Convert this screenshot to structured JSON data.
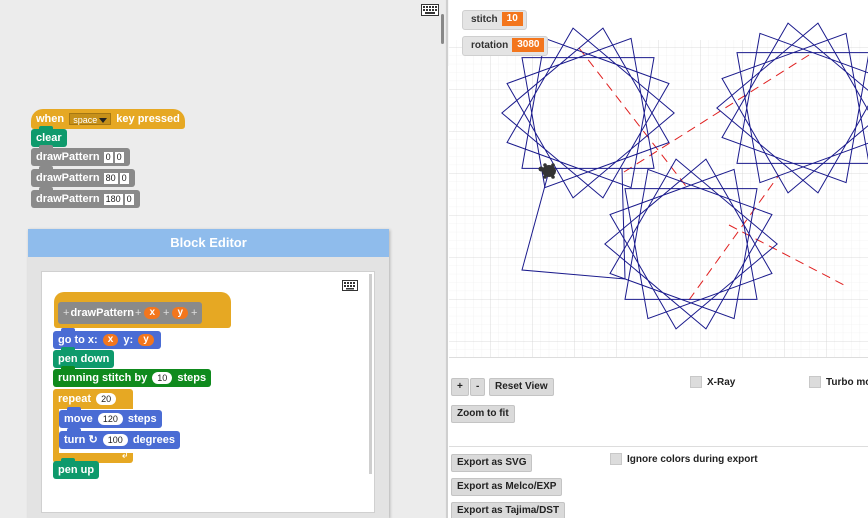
{
  "script": {
    "hat": {
      "when": "when",
      "key": "space",
      "pressed": "key pressed"
    },
    "clear": "clear",
    "calls": [
      {
        "name": "drawPattern",
        "x": "0",
        "y": "0"
      },
      {
        "name": "drawPattern",
        "x": "80",
        "y": "0"
      },
      {
        "name": "drawPattern",
        "x": "180",
        "y": "0"
      }
    ]
  },
  "block_editor": {
    "title": "Block Editor",
    "prototype": {
      "name": "drawPattern",
      "param_x": "x",
      "param_y": "y",
      "plus": "+"
    },
    "goto": {
      "label1": "go to x:",
      "var_x": "x",
      "label2": "y:",
      "var_y": "y"
    },
    "pen_down": "pen down",
    "running_stitch": {
      "label": "running stitch by",
      "value": "10",
      "suffix": "steps"
    },
    "repeat": {
      "label": "repeat",
      "value": "20"
    },
    "move": {
      "label": "move",
      "value": "120",
      "suffix": "steps"
    },
    "turn": {
      "label": "turn",
      "value": "100",
      "suffix": "degrees"
    },
    "pen_up": "pen up"
  },
  "stage": {
    "watchers": [
      {
        "label": "stitch",
        "value": "10"
      },
      {
        "label": "rotation",
        "value": "3080"
      }
    ],
    "controls": {
      "zoom_in": "+",
      "zoom_out": "-",
      "reset_view": "Reset View",
      "zoom_fit": "Zoom to fit",
      "xray": "X-Ray",
      "turbo": "Turbo mode",
      "export_svg": "Export as SVG",
      "export_exp": "Export as Melco/EXP",
      "export_dst": "Export as Tajima/DST",
      "ignore_colors": "Ignore colors during export"
    },
    "colors": {
      "stitch_line": "#1a1a8c",
      "jump_line": "#e02020",
      "grid": "#dcdcdc"
    }
  }
}
